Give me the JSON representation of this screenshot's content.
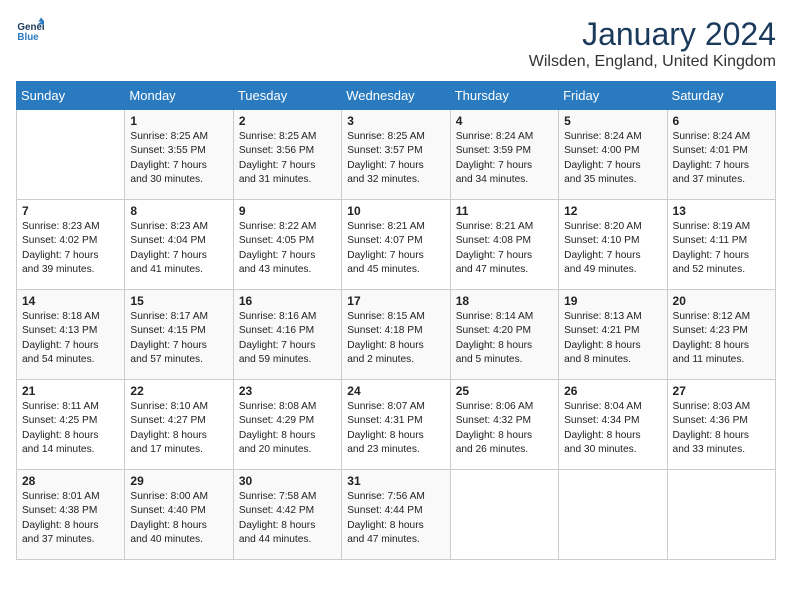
{
  "header": {
    "logo_line1": "General",
    "logo_line2": "Blue",
    "title": "January 2024",
    "subtitle": "Wilsden, England, United Kingdom"
  },
  "days_of_week": [
    "Sunday",
    "Monday",
    "Tuesday",
    "Wednesday",
    "Thursday",
    "Friday",
    "Saturday"
  ],
  "weeks": [
    [
      {
        "day": "",
        "text": ""
      },
      {
        "day": "1",
        "text": "Sunrise: 8:25 AM\nSunset: 3:55 PM\nDaylight: 7 hours\nand 30 minutes."
      },
      {
        "day": "2",
        "text": "Sunrise: 8:25 AM\nSunset: 3:56 PM\nDaylight: 7 hours\nand 31 minutes."
      },
      {
        "day": "3",
        "text": "Sunrise: 8:25 AM\nSunset: 3:57 PM\nDaylight: 7 hours\nand 32 minutes."
      },
      {
        "day": "4",
        "text": "Sunrise: 8:24 AM\nSunset: 3:59 PM\nDaylight: 7 hours\nand 34 minutes."
      },
      {
        "day": "5",
        "text": "Sunrise: 8:24 AM\nSunset: 4:00 PM\nDaylight: 7 hours\nand 35 minutes."
      },
      {
        "day": "6",
        "text": "Sunrise: 8:24 AM\nSunset: 4:01 PM\nDaylight: 7 hours\nand 37 minutes."
      }
    ],
    [
      {
        "day": "7",
        "text": "Sunrise: 8:23 AM\nSunset: 4:02 PM\nDaylight: 7 hours\nand 39 minutes."
      },
      {
        "day": "8",
        "text": "Sunrise: 8:23 AM\nSunset: 4:04 PM\nDaylight: 7 hours\nand 41 minutes."
      },
      {
        "day": "9",
        "text": "Sunrise: 8:22 AM\nSunset: 4:05 PM\nDaylight: 7 hours\nand 43 minutes."
      },
      {
        "day": "10",
        "text": "Sunrise: 8:21 AM\nSunset: 4:07 PM\nDaylight: 7 hours\nand 45 minutes."
      },
      {
        "day": "11",
        "text": "Sunrise: 8:21 AM\nSunset: 4:08 PM\nDaylight: 7 hours\nand 47 minutes."
      },
      {
        "day": "12",
        "text": "Sunrise: 8:20 AM\nSunset: 4:10 PM\nDaylight: 7 hours\nand 49 minutes."
      },
      {
        "day": "13",
        "text": "Sunrise: 8:19 AM\nSunset: 4:11 PM\nDaylight: 7 hours\nand 52 minutes."
      }
    ],
    [
      {
        "day": "14",
        "text": "Sunrise: 8:18 AM\nSunset: 4:13 PM\nDaylight: 7 hours\nand 54 minutes."
      },
      {
        "day": "15",
        "text": "Sunrise: 8:17 AM\nSunset: 4:15 PM\nDaylight: 7 hours\nand 57 minutes."
      },
      {
        "day": "16",
        "text": "Sunrise: 8:16 AM\nSunset: 4:16 PM\nDaylight: 7 hours\nand 59 minutes."
      },
      {
        "day": "17",
        "text": "Sunrise: 8:15 AM\nSunset: 4:18 PM\nDaylight: 8 hours\nand 2 minutes."
      },
      {
        "day": "18",
        "text": "Sunrise: 8:14 AM\nSunset: 4:20 PM\nDaylight: 8 hours\nand 5 minutes."
      },
      {
        "day": "19",
        "text": "Sunrise: 8:13 AM\nSunset: 4:21 PM\nDaylight: 8 hours\nand 8 minutes."
      },
      {
        "day": "20",
        "text": "Sunrise: 8:12 AM\nSunset: 4:23 PM\nDaylight: 8 hours\nand 11 minutes."
      }
    ],
    [
      {
        "day": "21",
        "text": "Sunrise: 8:11 AM\nSunset: 4:25 PM\nDaylight: 8 hours\nand 14 minutes."
      },
      {
        "day": "22",
        "text": "Sunrise: 8:10 AM\nSunset: 4:27 PM\nDaylight: 8 hours\nand 17 minutes."
      },
      {
        "day": "23",
        "text": "Sunrise: 8:08 AM\nSunset: 4:29 PM\nDaylight: 8 hours\nand 20 minutes."
      },
      {
        "day": "24",
        "text": "Sunrise: 8:07 AM\nSunset: 4:31 PM\nDaylight: 8 hours\nand 23 minutes."
      },
      {
        "day": "25",
        "text": "Sunrise: 8:06 AM\nSunset: 4:32 PM\nDaylight: 8 hours\nand 26 minutes."
      },
      {
        "day": "26",
        "text": "Sunrise: 8:04 AM\nSunset: 4:34 PM\nDaylight: 8 hours\nand 30 minutes."
      },
      {
        "day": "27",
        "text": "Sunrise: 8:03 AM\nSunset: 4:36 PM\nDaylight: 8 hours\nand 33 minutes."
      }
    ],
    [
      {
        "day": "28",
        "text": "Sunrise: 8:01 AM\nSunset: 4:38 PM\nDaylight: 8 hours\nand 37 minutes."
      },
      {
        "day": "29",
        "text": "Sunrise: 8:00 AM\nSunset: 4:40 PM\nDaylight: 8 hours\nand 40 minutes."
      },
      {
        "day": "30",
        "text": "Sunrise: 7:58 AM\nSunset: 4:42 PM\nDaylight: 8 hours\nand 44 minutes."
      },
      {
        "day": "31",
        "text": "Sunrise: 7:56 AM\nSunset: 4:44 PM\nDaylight: 8 hours\nand 47 minutes."
      },
      {
        "day": "",
        "text": ""
      },
      {
        "day": "",
        "text": ""
      },
      {
        "day": "",
        "text": ""
      }
    ]
  ]
}
